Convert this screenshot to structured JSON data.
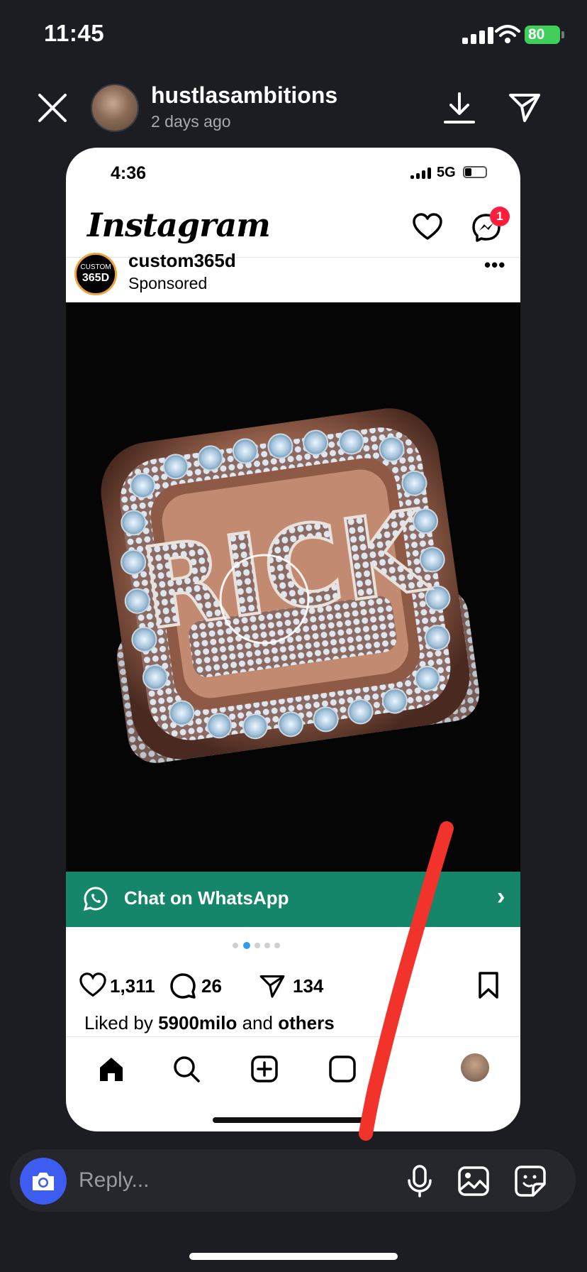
{
  "status_bar": {
    "time": "11:45",
    "battery": "80"
  },
  "story": {
    "username": "hustlasambitions",
    "time_ago": "2 days ago"
  },
  "inner_screen": {
    "status_time": "4:36",
    "network": "5G",
    "app_name": "Instagram",
    "message_badge": "1",
    "post": {
      "account": "custom365d",
      "logo_text_top": "CUSTOM",
      "logo_text_bottom": "365D",
      "label": "Sponsored",
      "ring_text": "RICK",
      "cta": "Chat on WhatsApp",
      "likes": "1,311",
      "comments": "26",
      "shares": "134",
      "liked_by_prefix": "Liked by ",
      "liked_by_user": "5900milo",
      "liked_by_middle": " and ",
      "liked_by_suffix": "others"
    }
  },
  "reply": {
    "placeholder": "Reply..."
  },
  "colors": {
    "whatsapp_green": "#15866a",
    "camera_blue": "#3d5cf0",
    "badge_red": "#ff1f3c",
    "annotation_red": "#f2332b"
  }
}
